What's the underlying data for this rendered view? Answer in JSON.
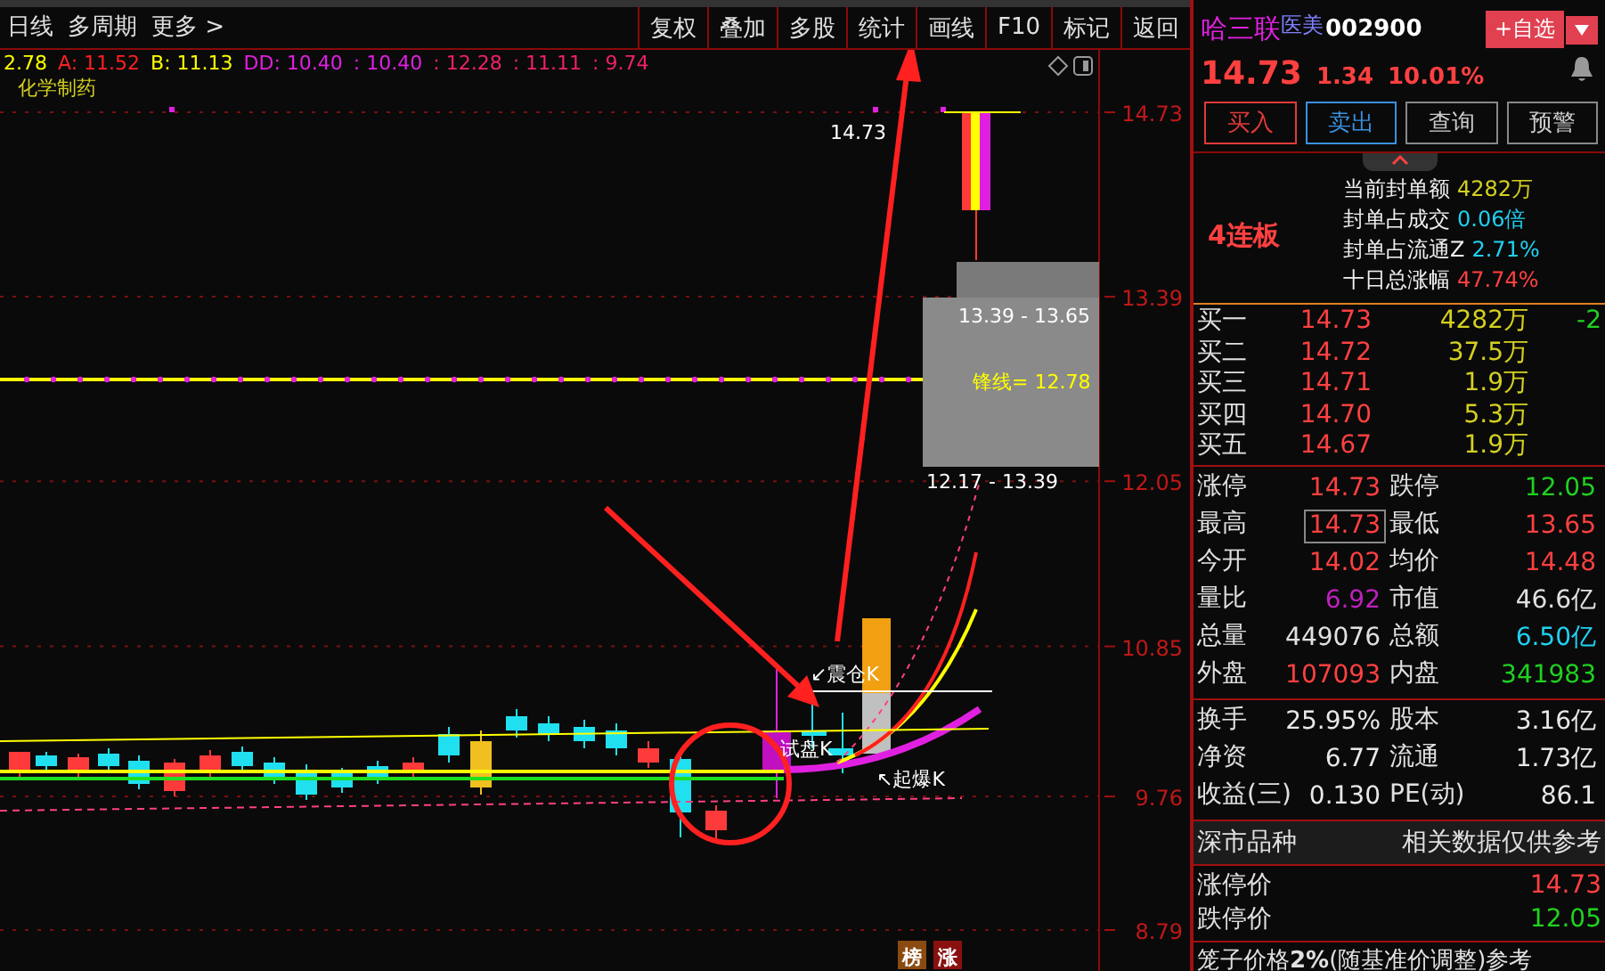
{
  "toolbar": {
    "left_items": [
      "日线",
      "多周期",
      "更多 >"
    ],
    "buttons": [
      "复权",
      "叠加",
      "多股",
      "统计",
      "画线",
      "F10",
      "标记",
      "返回"
    ]
  },
  "legend": {
    "items": [
      {
        "text": "2.78",
        "color": "#ffff00"
      },
      {
        "text": "A: 11.52",
        "color": "#ff2020"
      },
      {
        "text": "B: 11.13",
        "color": "#ffff00"
      },
      {
        "text": "DD: 10.40",
        "color": "#e020e0"
      },
      {
        "text": ": 10.40",
        "color": "#e020e0"
      },
      {
        "text": ": 12.28",
        "color": "#f0206a"
      },
      {
        "text": ": 11.11",
        "color": "#f0206a"
      },
      {
        "text": ": 9.74",
        "color": "#f0206a"
      }
    ],
    "sector": "化学制药"
  },
  "chart": {
    "price_axis": [
      "14.73",
      "13.39",
      "12.05",
      "10.85",
      "9.76",
      "8.79"
    ],
    "high_label": "14.73",
    "range_labels": [
      "13.39 - 13.65",
      "12.17 - 13.39"
    ],
    "line_label": "锋线= 12.78",
    "markers": [
      {
        "kind": "shakeout",
        "text": "↙震仓K"
      },
      {
        "kind": "probe",
        "text": "试盘K"
      },
      {
        "kind": "breakout",
        "text": "↖起爆K"
      }
    ],
    "badges": [
      {
        "text": "榜",
        "color": "#8a4a10"
      },
      {
        "text": "涨",
        "color": "#8a1010"
      }
    ]
  },
  "quote": {
    "name": "哈三联",
    "tag": "医美",
    "code": "002900",
    "watch_button": "+自选",
    "price": "14.73",
    "change": "1.34",
    "change_pct": "10.01%"
  },
  "actions": [
    {
      "label": "买入",
      "color": "#e03a3a"
    },
    {
      "label": "卖出",
      "color": "#3a90e0"
    },
    {
      "label": "查询",
      "color": "#888888"
    },
    {
      "label": "预警",
      "color": "#888888"
    }
  ],
  "streak": "4连板",
  "seal_stats": [
    {
      "label": "当前封单额",
      "value": "4282万",
      "color": "#d4d020"
    },
    {
      "label": "封单占成交",
      "value": "0.06倍",
      "color": "#20d0f0"
    },
    {
      "label": "封单占流通Z",
      "value": "2.71%",
      "color": "#20d0f0"
    },
    {
      "label": "十日总涨幅",
      "value": "47.74%",
      "color": "#ff4040"
    }
  ],
  "order_book": [
    {
      "label": "买一",
      "price": "14.73",
      "volume": "4282万",
      "change": "-2"
    },
    {
      "label": "买二",
      "price": "14.72",
      "volume": "37.5万"
    },
    {
      "label": "买三",
      "price": "14.71",
      "volume": "1.9万"
    },
    {
      "label": "买四",
      "price": "14.70",
      "volume": "5.3万"
    },
    {
      "label": "买五",
      "price": "14.67",
      "volume": "1.9万"
    }
  ],
  "quote_grid": [
    {
      "label": "涨停",
      "value": "14.73",
      "color": "#ff4040",
      "highlighted": false
    },
    {
      "label": "跌停",
      "value": "12.05",
      "color": "#20d020",
      "highlighted": false
    },
    {
      "label": "最高",
      "value": "14.73",
      "color": "#ff4040",
      "highlighted": true
    },
    {
      "label": "最低",
      "value": "13.65",
      "color": "#ff4040",
      "highlighted": false
    },
    {
      "label": "今开",
      "value": "14.02",
      "color": "#ff4040",
      "highlighted": false
    },
    {
      "label": "均价",
      "value": "14.48",
      "color": "#ff4040",
      "highlighted": false
    },
    {
      "label": "量比",
      "value": "6.92",
      "color": "#c020c0",
      "highlighted": false
    },
    {
      "label": "市值",
      "value": "46.6亿",
      "color": "#e0e0e0",
      "highlighted": false
    },
    {
      "label": "总量",
      "value": "449076",
      "color": "#e0e0e0",
      "highlighted": false
    },
    {
      "label": "总额",
      "value": "6.50亿",
      "color": "#20d0f0",
      "highlighted": false
    },
    {
      "label": "外盘",
      "value": "107093",
      "color": "#ff4040",
      "highlighted": false
    },
    {
      "label": "内盘",
      "value": "341983",
      "color": "#20d020",
      "highlighted": false
    }
  ],
  "extra_grid": [
    {
      "label": "换手",
      "value": "25.95%"
    },
    {
      "label": "股本",
      "value": "3.16亿"
    },
    {
      "label": "净资",
      "value": "6.77"
    },
    {
      "label": "流通",
      "value": "1.73亿"
    },
    {
      "label": "收益(三)",
      "value": "0.130"
    },
    {
      "label": "PE(动)",
      "value": "86.1"
    }
  ],
  "market": {
    "label": "深市品种",
    "note": "相关数据仅供参考"
  },
  "limits": [
    {
      "label": "涨停价",
      "value": "14.73",
      "color": "#ff4040"
    },
    {
      "label": "跌停价",
      "value": "12.05",
      "color": "#20d020"
    }
  ],
  "cage_note": "笼子价格**2%**(随基准价调整)参考"
}
